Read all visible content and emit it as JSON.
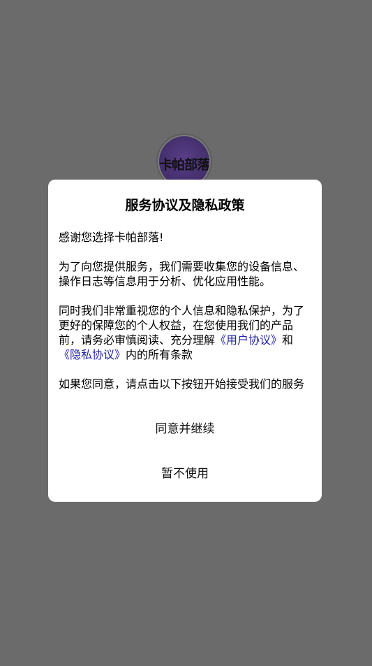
{
  "app": {
    "logo_text": "卡帕部落"
  },
  "dialog": {
    "title": "服务协议及隐私政策",
    "greeting": "感谢您选择卡帕部落!",
    "para_collect": "为了向您提供服务，我们需要收集您的设备信息、操作日志等信息用于分析、优化应用性能。",
    "para_privacy_start": "同时我们非常重视您的个人信息和隐私保护，为了更好的保障您的个人权益，在您使用我们的产品前，请务必审慎阅读、充分理解",
    "user_agreement_link": "《用户协议》",
    "and_text": "和",
    "privacy_agreement_link": "《隐私协议》",
    "para_privacy_end": "内的所有条款",
    "para_consent": "如果您同意，请点击以下按钮开始接受我们的服务",
    "agree_button": "同意并继续",
    "decline_button": "暂不使用"
  }
}
